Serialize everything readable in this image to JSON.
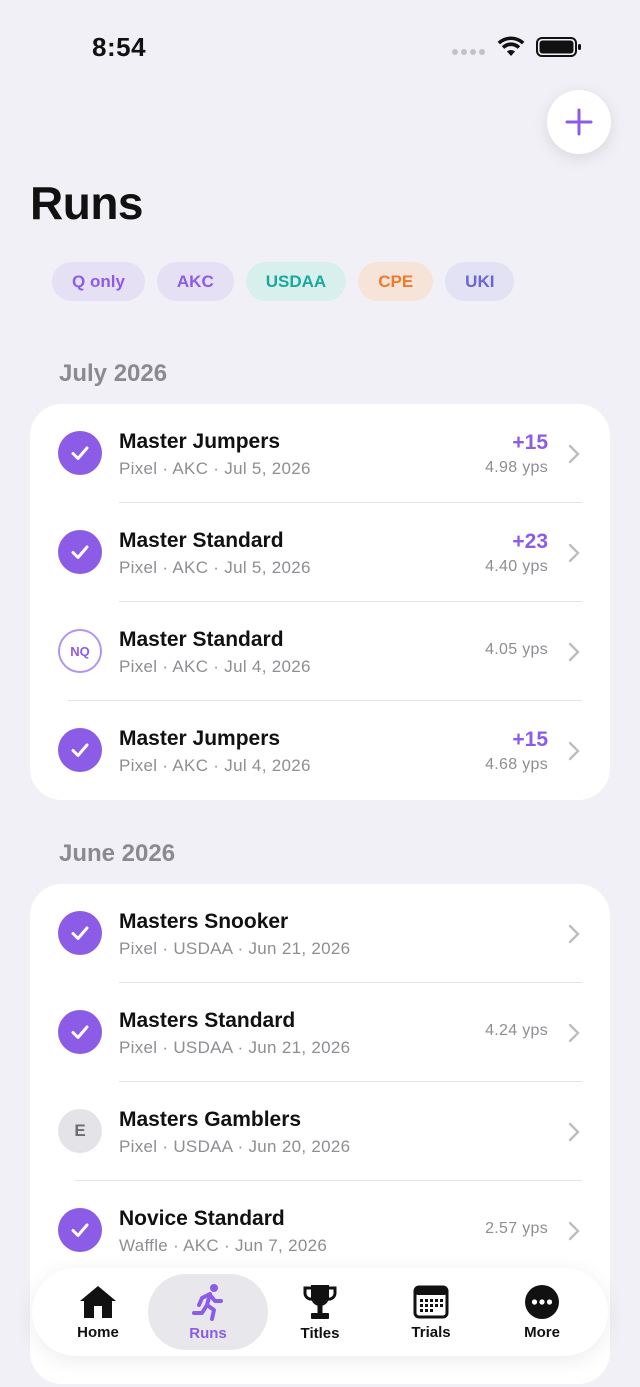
{
  "status": {
    "time": "8:54"
  },
  "header": {
    "title": "Runs"
  },
  "filters": [
    {
      "label": "Q only",
      "bg": "#e6e0f5",
      "fg": "#8c5ce6"
    },
    {
      "label": "AKC",
      "bg": "#e6e0f5",
      "fg": "#8c5ce6"
    },
    {
      "label": "USDAA",
      "bg": "#d7f0ee",
      "fg": "#1aa89a"
    },
    {
      "label": "CPE",
      "bg": "#f6e4d8",
      "fg": "#ef7b2a"
    },
    {
      "label": "UKI",
      "bg": "#e2e2f4",
      "fg": "#6b63d6"
    }
  ],
  "sections": [
    {
      "label": "July 2026",
      "runs": [
        {
          "result": "Q",
          "title": "Master Jumpers",
          "subtitle": "Pixel · AKC · Jul 5, 2026",
          "points": "+15",
          "yps": "4.98 yps"
        },
        {
          "result": "Q",
          "title": "Master Standard",
          "subtitle": "Pixel · AKC · Jul 5, 2026",
          "points": "+23",
          "yps": "4.40 yps"
        },
        {
          "result": "NQ",
          "title": "Master Standard",
          "subtitle": "Pixel · AKC · Jul 4, 2026",
          "points": "",
          "yps": "4.05 yps"
        },
        {
          "result": "Q",
          "title": "Master Jumpers",
          "subtitle": "Pixel · AKC · Jul 4, 2026",
          "points": "+15",
          "yps": "4.68 yps"
        }
      ]
    },
    {
      "label": "June 2026",
      "runs": [
        {
          "result": "Q",
          "title": "Masters Snooker",
          "subtitle": "Pixel · USDAA · Jun 21, 2026",
          "points": "",
          "yps": ""
        },
        {
          "result": "Q",
          "title": "Masters Standard",
          "subtitle": "Pixel · USDAA · Jun 21, 2026",
          "points": "",
          "yps": "4.24 yps"
        },
        {
          "result": "E",
          "title": "Masters Gamblers",
          "subtitle": "Pixel · USDAA · Jun 20, 2026",
          "points": "",
          "yps": ""
        },
        {
          "result": "Q",
          "title": "Novice Standard",
          "subtitle": "Waffle · AKC · Jun 7, 2026",
          "points": "",
          "yps": "2.57 yps"
        }
      ]
    }
  ],
  "tabs": [
    {
      "label": "Home",
      "icon": "house-icon"
    },
    {
      "label": "Runs",
      "icon": "runner-icon",
      "active": true
    },
    {
      "label": "Titles",
      "icon": "trophy-icon"
    },
    {
      "label": "Trials",
      "icon": "calendar-icon"
    },
    {
      "label": "More",
      "icon": "more-icon"
    }
  ]
}
